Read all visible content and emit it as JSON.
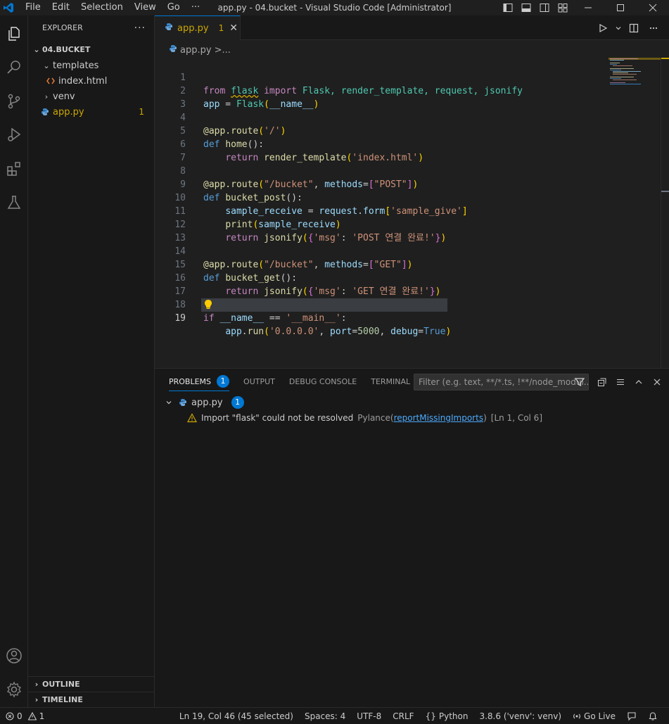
{
  "titlebar": {
    "menu": [
      "File",
      "Edit",
      "Selection",
      "View",
      "Go",
      "···"
    ],
    "title": "app.py - 04.bucket - Visual Studio Code [Administrator]"
  },
  "sidebar": {
    "header": "EXPLORER",
    "more": "···",
    "root": "04.BUCKET",
    "items": [
      {
        "label": "templates",
        "type": "folder-open"
      },
      {
        "label": "index.html",
        "type": "html-file"
      },
      {
        "label": "venv",
        "type": "folder-closed"
      },
      {
        "label": "app.py",
        "type": "python-file",
        "badge": "1"
      }
    ],
    "outline": "OUTLINE",
    "timeline": "TIMELINE"
  },
  "editor": {
    "tab": {
      "label": "app.py",
      "problems": "1"
    },
    "breadcrumb": {
      "file": "app.py",
      "rest": ">..."
    },
    "line_numbers": [
      "1",
      "2",
      "3",
      "4",
      "5",
      "6",
      "7",
      "8",
      "9",
      "10",
      "11",
      "12",
      "13",
      "14",
      "15",
      "16",
      "17",
      "18",
      "19"
    ],
    "tokens": {
      "l1": [
        "from",
        " ",
        "flask",
        " ",
        "import",
        " Flask, render_template, request, jsonify"
      ],
      "l2": [
        "app",
        " = ",
        "Flask",
        "(",
        "__name__",
        ")"
      ],
      "l4": [
        "@app.route",
        "(",
        "'/'",
        ")"
      ],
      "l5": [
        "def",
        " ",
        "home",
        "():"
      ],
      "l6": [
        "    ",
        "return",
        " ",
        "render_template",
        "(",
        "'index.html'",
        ")"
      ],
      "l8": [
        "@app.route",
        "(",
        "\"/bucket\"",
        ", ",
        "methods",
        "=",
        "[",
        "\"POST\"",
        "]",
        ")"
      ],
      "l9": [
        "def",
        " ",
        "bucket_post",
        "():"
      ],
      "l10": [
        "    ",
        "sample_receive",
        " = ",
        "request",
        ".",
        "form",
        "[",
        "'sample_give'",
        "]"
      ],
      "l11": [
        "    ",
        "print",
        "(",
        "sample_receive",
        ")"
      ],
      "l12": [
        "    ",
        "return",
        " ",
        "jsonify",
        "(",
        "{",
        "'msg'",
        ": ",
        "'POST 연결 완료!'",
        "}",
        ")"
      ],
      "l14": [
        "@app.route",
        "(",
        "\"/bucket\"",
        ", ",
        "methods",
        "=",
        "[",
        "\"GET\"",
        "]",
        ")"
      ],
      "l15": [
        "def",
        " ",
        "bucket_get",
        "():"
      ],
      "l16": [
        "    ",
        "return",
        " ",
        "jsonify",
        "(",
        "{",
        "'msg'",
        ": ",
        "'GET 연결 완료!'",
        "}",
        ")"
      ],
      "l18": [
        "if",
        " ",
        "__name__",
        " == ",
        "'__main__'",
        ":"
      ],
      "l19": [
        "    ",
        "app",
        ".",
        "run",
        "(",
        "'0.0.0.0'",
        ", ",
        "port",
        "=",
        "5000",
        ", ",
        "debug",
        "=",
        "True",
        ")"
      ]
    }
  },
  "panel": {
    "tabs": [
      "PROBLEMS",
      "OUTPUT",
      "DEBUG CONSOLE",
      "TERMINAL"
    ],
    "problems_count": "1",
    "filter_placeholder": "Filter (e.g. text, **/*.ts, !**/node_modul...",
    "file": "app.py",
    "file_count": "1",
    "problem": {
      "message": "Import \"flask\" could not be resolved",
      "source": "Pylance",
      "code": "reportMissingImports",
      "open_paren": "(",
      "close_paren": ")",
      "position": "[Ln 1, Col 6]"
    }
  },
  "statusbar": {
    "errors": "0",
    "warnings": "1",
    "cursor": "Ln 19, Col 46 (45 selected)",
    "spaces": "Spaces: 4",
    "encoding": "UTF-8",
    "eol": "CRLF",
    "language": "Python",
    "interpreter": "3.8.6 ('venv': venv)",
    "golive": "Go Live"
  },
  "colors": {
    "accent": "#0078d4",
    "warning": "#cca700",
    "background": "#1f1f1f",
    "sidebar": "#181818"
  }
}
